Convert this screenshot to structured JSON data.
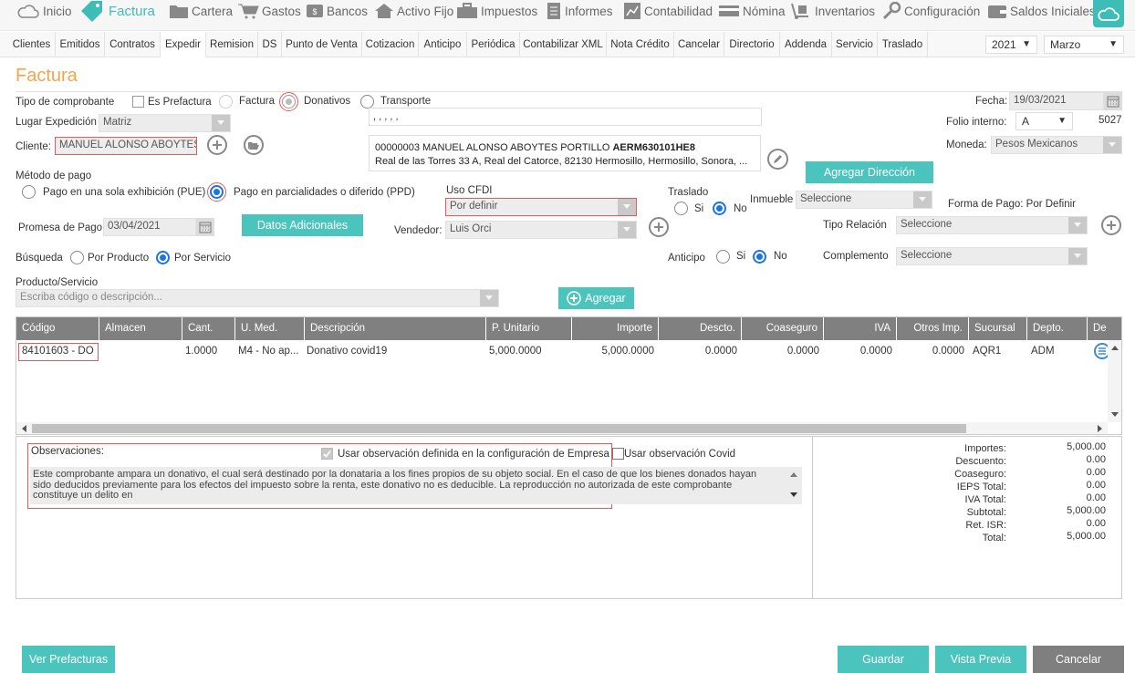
{
  "topnav": {
    "items": [
      {
        "label": "Inicio",
        "icon": "cloud-icon"
      },
      {
        "label": "Factura",
        "icon": "tag-icon"
      },
      {
        "label": "Cartera",
        "icon": "folder-icon"
      },
      {
        "label": "Gastos",
        "icon": "cart-icon"
      },
      {
        "label": "Bancos",
        "icon": "bank-icon"
      },
      {
        "label": "Activo Fijo",
        "icon": "house-icon"
      },
      {
        "label": "Impuestos",
        "icon": "briefcase-icon"
      },
      {
        "label": "Informes",
        "icon": "document-icon"
      },
      {
        "label": "Contabilidad",
        "icon": "chart-icon"
      },
      {
        "label": "Nómina",
        "icon": "card-icon"
      },
      {
        "label": "Inventarios",
        "icon": "dolly-icon"
      },
      {
        "label": "Configuración",
        "icon": "wrench-icon"
      },
      {
        "label": "Saldos Iniciales",
        "icon": "wallet-icon"
      }
    ],
    "active": "Factura"
  },
  "subnav": {
    "items": [
      "Clientes",
      "Emitidos",
      "Contratos",
      "Expedir",
      "Remision",
      "DS",
      "Punto de Venta",
      "Cotizacion",
      "Anticipo",
      "Periódica",
      "Contabilizar XML",
      "Nota Crédito",
      "Cancelar",
      "Directorio",
      "Addenda",
      "Servicio",
      "Traslado"
    ],
    "active": "Expedir",
    "year": "2021",
    "month": "Marzo"
  },
  "page": {
    "title": "Factura"
  },
  "form": {
    "tipo_label": "Tipo de comprobante",
    "es_prefactura": "Es Prefactura",
    "opt_factura": "Factura",
    "opt_donativos": "Donativos",
    "opt_transporte": "Transporte",
    "lugar_label": "Lugar Expedición",
    "lugar_value": "Matriz",
    "address_placeholder": ", , , , ,",
    "cliente_label": "Cliente:",
    "cliente_value": "MANUEL ALONSO ABOYTES PORTILLO",
    "client_line1": "00000003 MANUEL ALONSO ABOYTES PORTILLO",
    "client_rfc": "AERM630101HE8",
    "client_line2": "Real de las Torres 33 A, Real del Catorce, 82130 Hermosillo, Hermosillo, Sonora, ...",
    "fecha_label": "Fecha:",
    "fecha_value": "19/03/2021",
    "folio_label": "Folio interno:",
    "folio_serie": "A",
    "folio_num": "5027",
    "moneda_label": "Moneda:",
    "moneda_value": "Pesos Mexicanos",
    "agregar_direccion": "Agregar Dirección",
    "metodo_label": "Método de pago",
    "pue_label": "Pago en una sola exhibición (PUE)",
    "ppd_label": "Pago en parcialidades o diferido (PPD)",
    "uso_label": "Uso CFDI",
    "uso_value": "Por definir",
    "traslado_label": "Traslado",
    "si": "Si",
    "no": "No",
    "inmueble_label": "Inmueble",
    "inmueble_value": "Seleccione",
    "forma_pago": "Forma de Pago: Por Definir",
    "promesa_label": "Promesa de Pago",
    "promesa_value": "03/04/2021",
    "datos_adicionales": "Datos Adicionales",
    "vendedor_label": "Vendedor:",
    "vendedor_value": "Luis Orci",
    "tipo_relacion_label": "Tipo Relación",
    "tipo_relacion_value": "Seleccione",
    "busqueda_label": "Búsqueda",
    "por_producto": "Por Producto",
    "por_servicio": "Por Servicio",
    "anticipo_label": "Anticipo",
    "complemento_label": "Complemento",
    "complemento_value": "Seleccione",
    "producto_label": "Producto/Servicio",
    "producto_placeholder": "Escriba código o descripción...",
    "agregar": "Agregar"
  },
  "grid": {
    "headers": [
      "Código",
      "Almacen",
      "Cant.",
      "U. Med.",
      "Descripción",
      "P. Unitario",
      "Importe",
      "Descto.",
      "Coaseguro",
      "IVA",
      "Otros Imp.",
      "Sucursal",
      "Depto.",
      "De"
    ],
    "row": [
      "84101603 - DO",
      "",
      "1.0000",
      "M4 - No ap...",
      "Donativo covid19",
      "5,000.0000",
      "5,000.0000",
      "0.0000",
      "0.0000",
      "0.0000",
      "0.0000",
      "AQR1",
      "ADM"
    ]
  },
  "obs": {
    "label": "Observaciones:",
    "usar_empresa": "Usar observación definida en la configuración de Empresa",
    "usar_covid": "Usar observación Covid",
    "text": "Este comprobante ampara un donativo, el cual será destinado por la donataria a los fines propios de su objeto social. En el caso de que los bienes donados hayan sido deducidos previamente para los efectos del impuesto sobre la renta, este donativo no es deducible. La reproducción no autorizada de este comprobante constituye un delito en"
  },
  "totals": [
    {
      "label": "Importes:",
      "value": "5,000.00"
    },
    {
      "label": "Descuento:",
      "value": "0.00"
    },
    {
      "label": "Coaseguro:",
      "value": "0.00"
    },
    {
      "label": "IEPS Total:",
      "value": "0.00"
    },
    {
      "label": "IVA Total:",
      "value": "0.00"
    },
    {
      "label": "Subtotal:",
      "value": "5,000.00"
    },
    {
      "label": "Ret. ISR:",
      "value": "0.00"
    },
    {
      "label": "Total:",
      "value": "5,000.00"
    }
  ],
  "footer": {
    "ver_prefacturas": "Ver Prefacturas",
    "guardar": "Guardar",
    "vista_previa": "Vista Previa",
    "cancelar": "Cancelar"
  },
  "colors": {
    "accent": "#3ebdb6",
    "title": "#f4a54a",
    "header_gray": "#808080",
    "error": "#e85a5a",
    "cancel": "#7f7f7f"
  }
}
